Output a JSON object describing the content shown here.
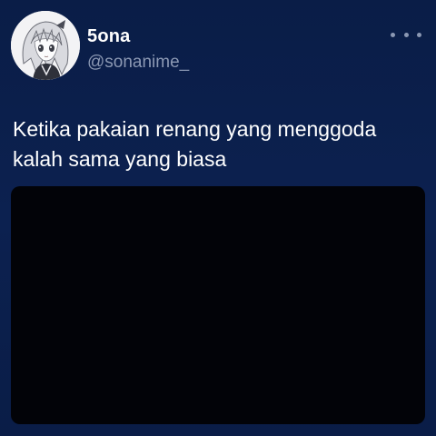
{
  "tweet": {
    "author": {
      "display_name": "5ona",
      "handle": "@sonanime_",
      "avatar_icon": "anime-avatar-icon"
    },
    "more_icon": "more-horizontal-icon",
    "text_line_1": "Ketika pakaian renang yang menggoda",
    "text_line_2": "kalah sama yang biasa"
  },
  "colors": {
    "background": "#0c2150",
    "secondary_text": "#8b98b3",
    "media_background": "#020308"
  }
}
